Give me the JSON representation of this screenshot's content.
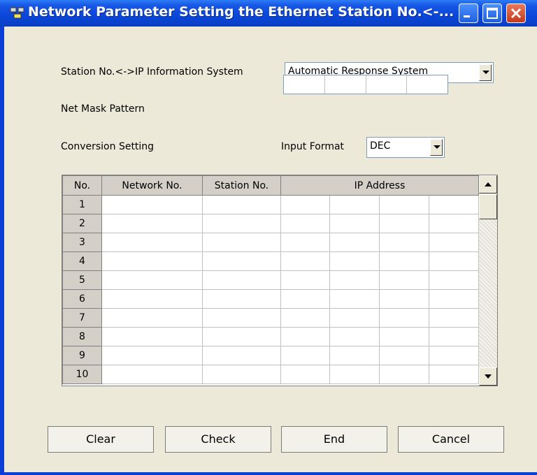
{
  "window": {
    "title": "Network Parameter  Setting the Ethernet Station No.<-...",
    "colors": {
      "titlebar": "#0a46d8",
      "client": "#ece9d8",
      "close": "#c4381a"
    }
  },
  "form": {
    "station_ip_label": "Station No.<->IP Information System",
    "station_ip_value": "Automatic Response System",
    "net_mask_label": "Net Mask Pattern",
    "conversion_label": "Conversion Setting",
    "input_format_label": "Input Format",
    "input_format_value": "DEC"
  },
  "table": {
    "headers": {
      "no": "No.",
      "network": "Network No.",
      "station": "Station No.",
      "ip": "IP Address"
    },
    "rows": [
      "1",
      "2",
      "3",
      "4",
      "5",
      "6",
      "7",
      "8",
      "9",
      "10"
    ]
  },
  "buttons": {
    "clear": "Clear",
    "check": "Check",
    "end": "End",
    "cancel": "Cancel"
  },
  "icons": {
    "title": "network-parameter-icon",
    "min": "minimize-icon",
    "max": "maximize-icon",
    "close": "close-icon"
  }
}
